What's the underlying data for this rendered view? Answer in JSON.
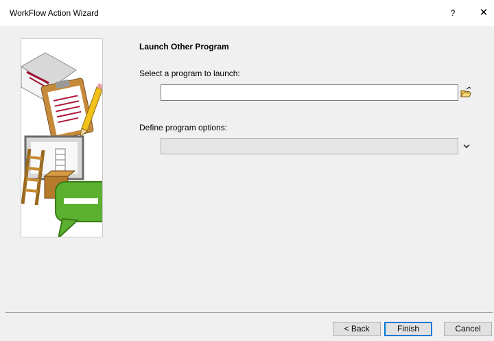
{
  "window": {
    "title": "WorkFlow Action Wizard",
    "help_label": "?",
    "close_label": "✕"
  },
  "page": {
    "section_title": "Launch Other Program",
    "program_label": "Select a program to launch:",
    "program_value": "",
    "options_label": "Define program options:",
    "options_value": ""
  },
  "icons": {
    "browse": "folder-open-icon",
    "dropdown": "chevron-down-icon"
  },
  "buttons": {
    "back": "< Back",
    "finish": "Finish",
    "cancel": "Cancel"
  },
  "colors": {
    "accent": "#0078d7",
    "background": "#f0f0f0"
  }
}
